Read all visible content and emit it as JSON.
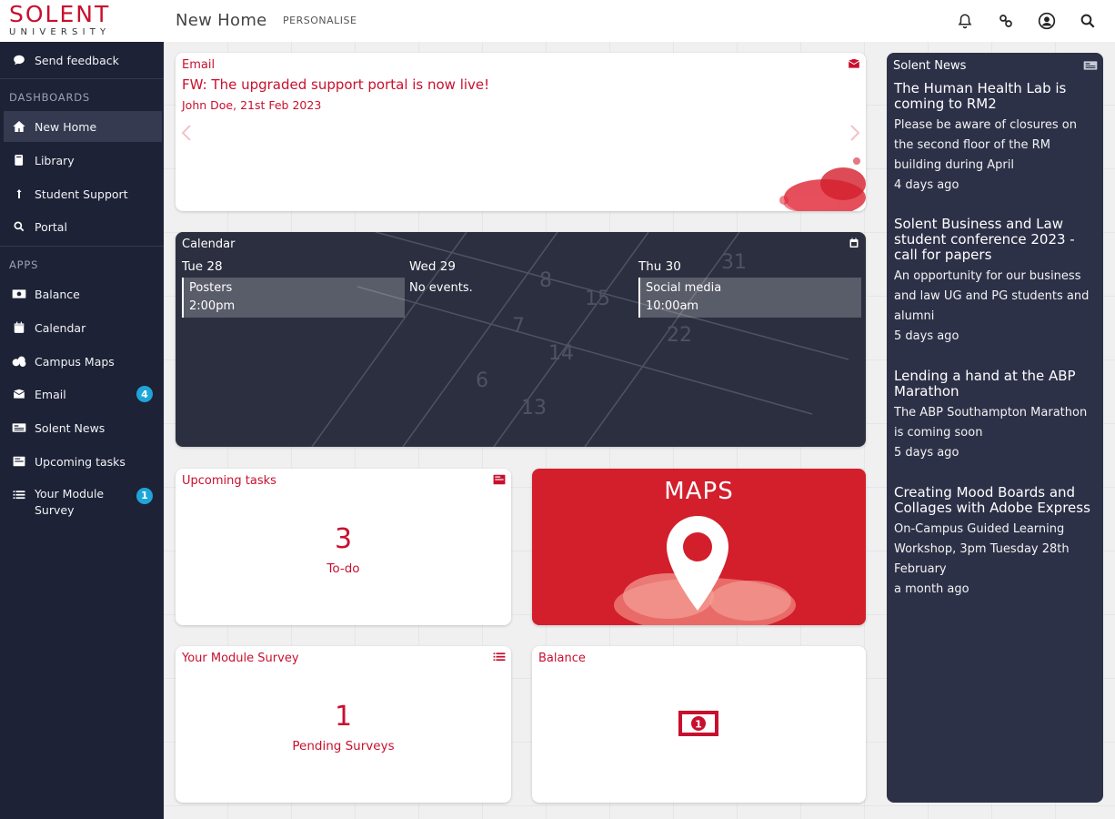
{
  "header": {
    "logo_main": "SOLENT",
    "logo_sub": "UNIVERSITY",
    "page_title": "New Home",
    "personalise_label": "PERSONALISE",
    "icons": [
      "bell-icon",
      "link-icon",
      "account-icon",
      "search-icon"
    ]
  },
  "sidebar": {
    "feedback_label": "Send feedback",
    "dashboards_heading": "DASHBOARDS",
    "dashboards": [
      {
        "label": "New Home",
        "icon": "home-icon"
      },
      {
        "label": "Library",
        "icon": "book-icon"
      },
      {
        "label": "Student Support",
        "icon": "support-icon"
      },
      {
        "label": "Portal",
        "icon": "portal-icon"
      }
    ],
    "apps_heading": "APPS",
    "apps": [
      {
        "label": "Balance",
        "icon": "money-icon"
      },
      {
        "label": "Calendar",
        "icon": "calendar-icon"
      },
      {
        "label": "Campus Maps",
        "icon": "map-icon"
      },
      {
        "label": "Email",
        "icon": "mail-icon",
        "badge": "4"
      },
      {
        "label": "Solent News",
        "icon": "news-icon"
      },
      {
        "label": "Upcoming tasks",
        "icon": "tasks-icon"
      },
      {
        "label": "Your Module Survey",
        "icon": "survey-icon",
        "badge": "1"
      }
    ]
  },
  "email_card": {
    "title": "Email",
    "subject": "FW: The upgraded support portal is now live!",
    "meta": "John Doe, 21st Feb 2023"
  },
  "calendar_card": {
    "title": "Calendar",
    "days": [
      {
        "day": "Tue 28",
        "event_title": "Posters",
        "event_time": "2:00pm"
      },
      {
        "day": "Wed 29",
        "none_text": "No events."
      },
      {
        "day": "Thu 30",
        "event_title": "Social media",
        "event_time": "10:00am"
      }
    ]
  },
  "tasks_card": {
    "title": "Upcoming tasks",
    "count": "3",
    "label": "To-do"
  },
  "maps_card": {
    "title": "MAPS"
  },
  "survey_card": {
    "title": "Your Module Survey",
    "count": "1",
    "label": "Pending Surveys"
  },
  "balance_card": {
    "title": "Balance"
  },
  "news_panel": {
    "title": "Solent News",
    "items": [
      {
        "headline": "The Human Health Lab is coming to RM2",
        "body": "Please be aware of closures on the second floor of the RM building during April",
        "time": "4 days ago"
      },
      {
        "headline": "Solent Business and Law student conference 2023 - call for papers",
        "body": "An opportunity for our business and law UG and PG students and alumni",
        "time": "5 days ago"
      },
      {
        "headline": "Lending a hand at the ABP Marathon",
        "body": "The ABP Southampton Marathon is coming soon",
        "time": "5 days ago"
      },
      {
        "headline": "Creating Mood Boards and Collages with Adobe Express",
        "body": "On-Campus Guided Learning Workshop, 3pm Tuesday 28th February",
        "time": "a month ago"
      }
    ]
  },
  "colors": {
    "brand_red": "#c8102e",
    "sidebar_bg": "#1e2236",
    "badge_blue": "#1ea5d7",
    "news_bg": "#2d3148"
  }
}
